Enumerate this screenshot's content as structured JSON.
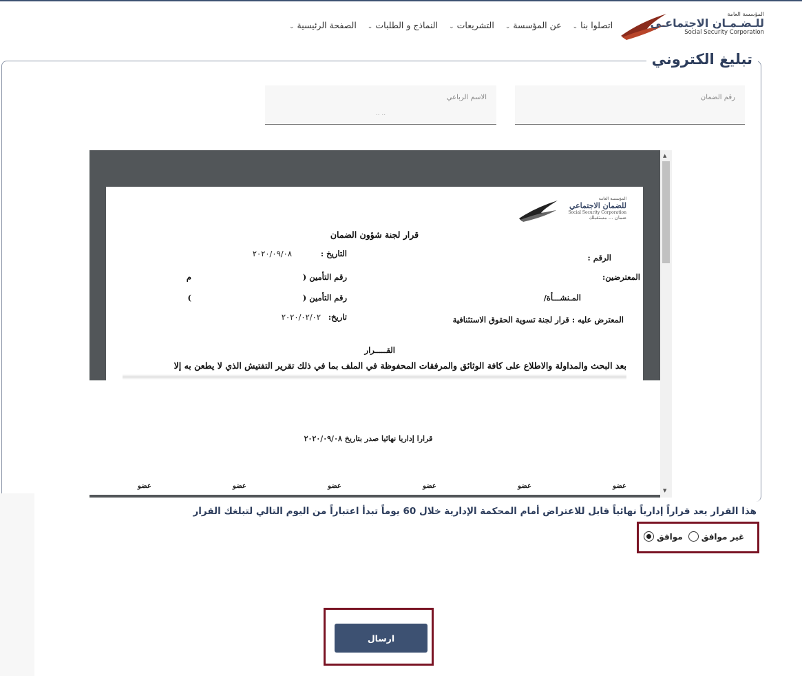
{
  "header": {
    "logo_line1": "المؤسسة العامة",
    "logo_line2": "للـضـمـان الاجتماعـي",
    "logo_line3": "Social Security Corporation",
    "nav": [
      {
        "label": "الصفحة الرئيسية"
      },
      {
        "label": "النماذج و الطلبات"
      },
      {
        "label": "التشريعات"
      },
      {
        "label": "عن المؤسسة"
      },
      {
        "label": "اتصلوا بنا"
      }
    ]
  },
  "page_title": "تبليغ الكتروني",
  "form": {
    "guarantee_number_label": "رقم الضمان",
    "full_name_label": "الاسم الرباعي",
    "full_name_value": "..          ..",
    "guarantee_number_value": ""
  },
  "document": {
    "logo_line1": "المؤسسة العامة",
    "logo_line2": "للضمان الاجتماعي",
    "logo_line3": "Social Security Corporation",
    "logo_line4": "ضمان ... مستقبلك",
    "title": "قرار لجنة شؤون الضمان",
    "number_label": "الرقم   :",
    "date_label": "التاريخ  :",
    "date_value": "٢٠٢٠/٠٩/٠٨",
    "objectors_label": "المعترضين:",
    "insurance_label_1": "رقم التأمين (",
    "insurance_suffix_1": "م",
    "establishment_label": "المـنشـــأة/",
    "insurance_label_2": "رقم التأمين (",
    "insurance_suffix_2": ")",
    "objected_to": "المعترض عليه : قرار لجنة تسوية الحقوق الاستئنافية",
    "date2_label": "تاريخ:",
    "date2_value": "٢٠٢٠/٠٢/٠٢",
    "decision_heading": "القـــــرار",
    "body_text": "بعد البحث والمداولة والاطلاع على كافة الوثائق والمرفقات المحفوظة في الملف بما في ذلك تقرير التفتيش الذي لا يطعن به إلا",
    "final_text": "قرارا إداريا نهائيا صدر بتاريخ  ٢٠٢٠/٠٩/٠٨",
    "members": [
      "عضو",
      "عضو",
      "عضو",
      "عضو",
      "عضو",
      "عضو"
    ]
  },
  "notice": "هذا القرار يعد قراراً إدارياً نهائياً قابل للاعتراض أمام المحكمة الإدارية خلال 60 يوماً تبدأ اعتباراً من اليوم التالي لتبلغك القرار",
  "consent": {
    "agree_label": "موافق",
    "disagree_label": "غير موافق",
    "selected": "agree"
  },
  "submit_label": "ارسال"
}
